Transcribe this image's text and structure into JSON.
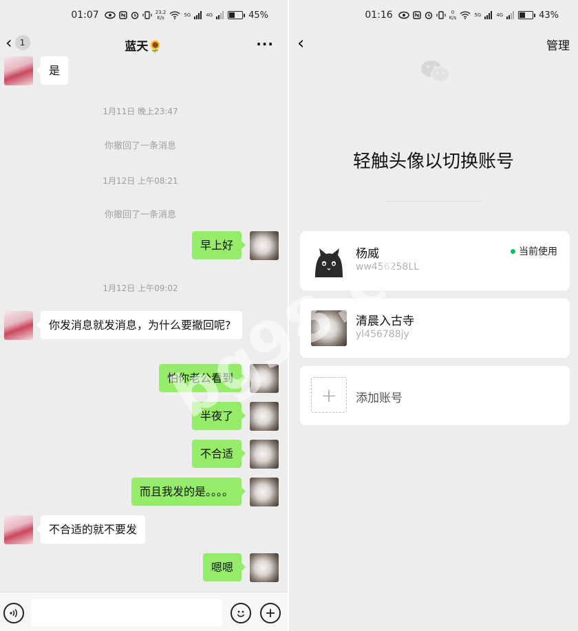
{
  "left": {
    "status": {
      "time": "01:07",
      "speed_value": "23.2",
      "speed_unit": "K/s",
      "net1": "5G",
      "net2": "4G",
      "battery": "45%",
      "battery_level": 0.45
    },
    "header": {
      "title": "蓝天🌻",
      "unread_count": "1",
      "more_label": "···"
    },
    "messages": {
      "m0": "是",
      "t1": "1月11日 晚上23:47",
      "s1": "你撤回了一条消息",
      "t2": "1月12日 上午08:21",
      "s2": "你撤回了一条消息",
      "m1": "早上好",
      "t3": "1月12日 上午09:02",
      "m2": "你发消息就发消息，为什么要撤回呢?",
      "m3": "怕你老公看到",
      "m4": "半夜了",
      "m5": "不合适",
      "m6": "而且我发的是。。。。",
      "m7": "不合适的就不要发",
      "m8": "嗯嗯"
    },
    "input": {
      "value": ""
    }
  },
  "right": {
    "status": {
      "time": "01:16",
      "speed_value": "0",
      "speed_unit": "K/s",
      "net1": "5G",
      "net2": "4G",
      "battery": "43%",
      "battery_level": 0.43
    },
    "manage_label": "管理",
    "title": "轻触头像以切换账号",
    "accounts": [
      {
        "name": "杨威",
        "id": "ww456258LL",
        "status": "当前使用"
      },
      {
        "name": "清晨入古寺",
        "id": "yl456788jy"
      }
    ],
    "add_label": "添加账号"
  },
  "watermark": "bg98.cc",
  "colors": {
    "bubble_out": "#95ec69",
    "bubble_in": "#ffffff",
    "bg": "#ededed",
    "active_dot": "#07c160"
  }
}
